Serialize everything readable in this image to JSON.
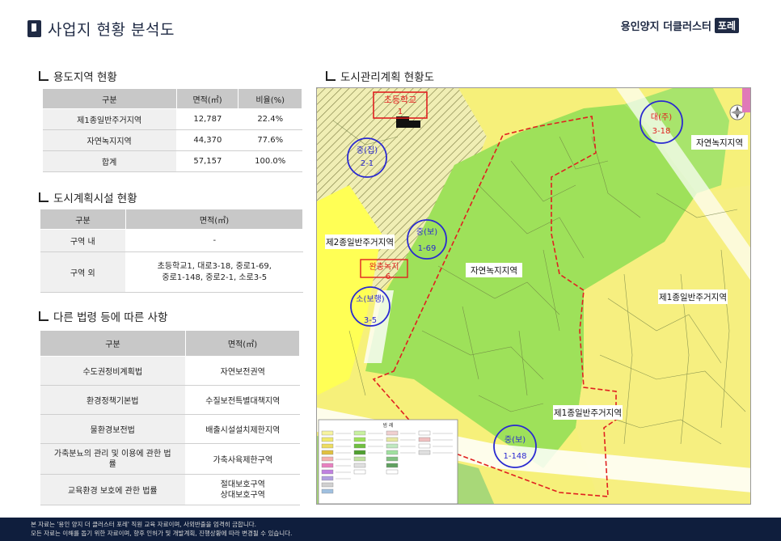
{
  "header": {
    "title": "사업지 현황 분석도",
    "brand_text": "용인양지 더클러스터",
    "brand_badge": "포레"
  },
  "section1": {
    "title": "용도지역 현황",
    "columns": [
      "구분",
      "면적(㎡)",
      "비율(%)"
    ],
    "rows": [
      [
        "제1종일반주거지역",
        "12,787",
        "22.4%"
      ],
      [
        "자연녹지지역",
        "44,370",
        "77.6%"
      ],
      [
        "합계",
        "57,157",
        "100.0%"
      ]
    ]
  },
  "section2": {
    "title": "도시계획시설 현황",
    "columns": [
      "구분",
      "면적(㎡)"
    ],
    "rows": [
      [
        "구역 내",
        "-"
      ],
      [
        "구역 외",
        "초등학교1, 대로3-18, 중로1-69,",
        "중로1-148, 중로2-1, 소로3-5"
      ]
    ]
  },
  "section3": {
    "title": "다른 법령 등에 따른 사항",
    "columns": [
      "구분",
      "면적(㎡)"
    ],
    "rows": [
      [
        "수도권정비계획법",
        "자연보전권역"
      ],
      [
        "환경정책기본법",
        "수질보전특별대책지역"
      ],
      [
        "물환경보전법",
        "배출시설설치제한지역"
      ],
      [
        "가축분뇨의 관리 및 이용에 관한 법",
        "률",
        "가축사육제한구역"
      ],
      [
        "교육환경 보호에 관한 법률",
        "절대보호구역",
        "상대보호구역"
      ]
    ]
  },
  "map": {
    "title": "도시관리계획 현황도",
    "labels": {
      "school": "초등학교",
      "school_num": "1",
      "zone_natural_green_top": "자연녹지지역",
      "zone_residential2": "제2종일반주거지역",
      "zone_natural_green_mid": "자연녹지지역",
      "zone_residential1_right": "제1종일반주거지역",
      "zone_residential1_bottom": "제1종일반주거지역",
      "buffer_green": "완충녹지",
      "buffer_green_num": "6",
      "legend_title": "범 례"
    },
    "roads": [
      {
        "top": "중(집)",
        "bottom": "2-1"
      },
      {
        "top": "대(주)",
        "bottom": "3-18"
      },
      {
        "top": "중(보)",
        "bottom": "1-69"
      },
      {
        "top": "소(보행)",
        "bottom": "3-5"
      },
      {
        "top": "중(보)",
        "bottom": "1-148"
      }
    ],
    "colors": {
      "green": "#9ee15a",
      "yellow": "#ffff66",
      "pale_yellow": "#f5f07a",
      "boundary": "#e02020",
      "road_circle": "#2a2ad0",
      "water": "#3a6fd8"
    }
  },
  "footer": {
    "line1": "본 자료는 '용인 양지 더 클러스터 포레' 직원 교육 자료이며, 사외반출을 엄격히 금합니다.",
    "line2": "모든 자료는 이해를 돕기 위한 자료이며, 향후 인허가 및 개발계획, 진행상황에 따라 변경될 수 있습니다."
  }
}
